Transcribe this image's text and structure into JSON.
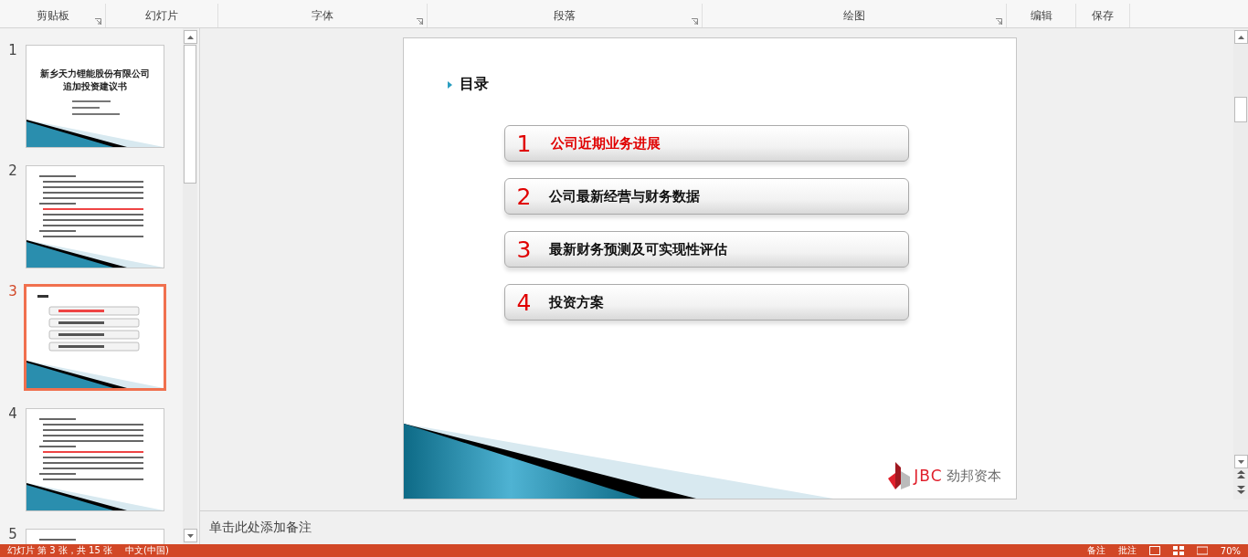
{
  "ribbon": {
    "groups": [
      {
        "label": "剪贴板",
        "launcher": true
      },
      {
        "label": "幻灯片",
        "launcher": false
      },
      {
        "label": "字体",
        "launcher": true
      },
      {
        "label": "段落",
        "launcher": true
      },
      {
        "label": "绘图",
        "launcher": true
      },
      {
        "label": "编辑",
        "launcher": false
      },
      {
        "label": "保存",
        "launcher": false
      }
    ]
  },
  "thumbnails": [
    {
      "number": "1",
      "selected": false,
      "kind": "title",
      "title_lines": [
        "新乡天力锂能股份有限公司",
        "追加投资建议书"
      ]
    },
    {
      "number": "2",
      "selected": false,
      "kind": "text"
    },
    {
      "number": "3",
      "selected": true,
      "kind": "toc"
    },
    {
      "number": "4",
      "selected": false,
      "kind": "text"
    },
    {
      "number": "5",
      "selected": false,
      "kind": "text"
    }
  ],
  "slide": {
    "heading": "目录",
    "items": [
      {
        "number": "1",
        "label": "公司近期业务进展",
        "highlighted": true
      },
      {
        "number": "2",
        "label": "公司最新经营与财务数据",
        "highlighted": false
      },
      {
        "number": "3",
        "label": "最新财务预测及可实现性评估",
        "highlighted": false
      },
      {
        "number": "4",
        "label": "投资方案",
        "highlighted": false
      }
    ],
    "logo": {
      "mark": "JBC",
      "name": "劲邦资本"
    }
  },
  "notes": {
    "placeholder": "单击此处添加备注"
  },
  "status_bar": {
    "slide_info": "幻灯片 第 3 张，共 15 张",
    "language": "中文(中国)",
    "notes_button": "备注",
    "comments_button": "批注",
    "zoom": "70%"
  }
}
